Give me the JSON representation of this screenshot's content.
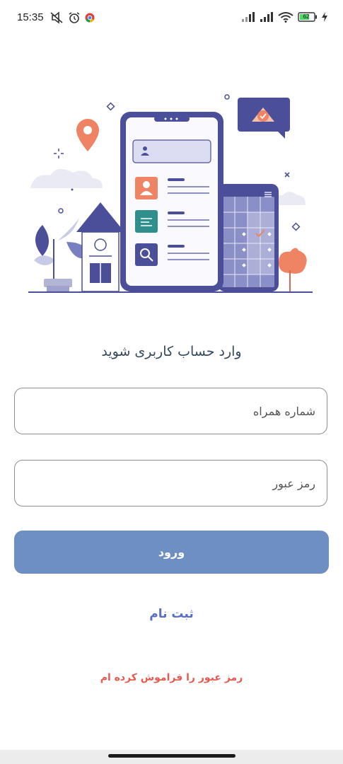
{
  "status_bar": {
    "time": "15:35",
    "battery_level": "62",
    "icons": [
      "muted-icon",
      "alarm-icon",
      "chrome-icon",
      "signal-icon",
      "signal-icon",
      "wifi-icon",
      "battery-icon",
      "charging-icon"
    ]
  },
  "login": {
    "title": "وارد حساب کاربری شوید",
    "phone_placeholder": "شماره همراه",
    "password_placeholder": "رمز عبور",
    "submit_label": "ورود",
    "register_label": "ثبت نام",
    "forgot_label": "رمز عبور را فراموش کرده ام"
  },
  "colors": {
    "primary_button": "#6e8fc1",
    "register_link": "#5a6fc4",
    "forgot_link": "#e85a4f",
    "illustration_accent": "#4b4f9a"
  }
}
